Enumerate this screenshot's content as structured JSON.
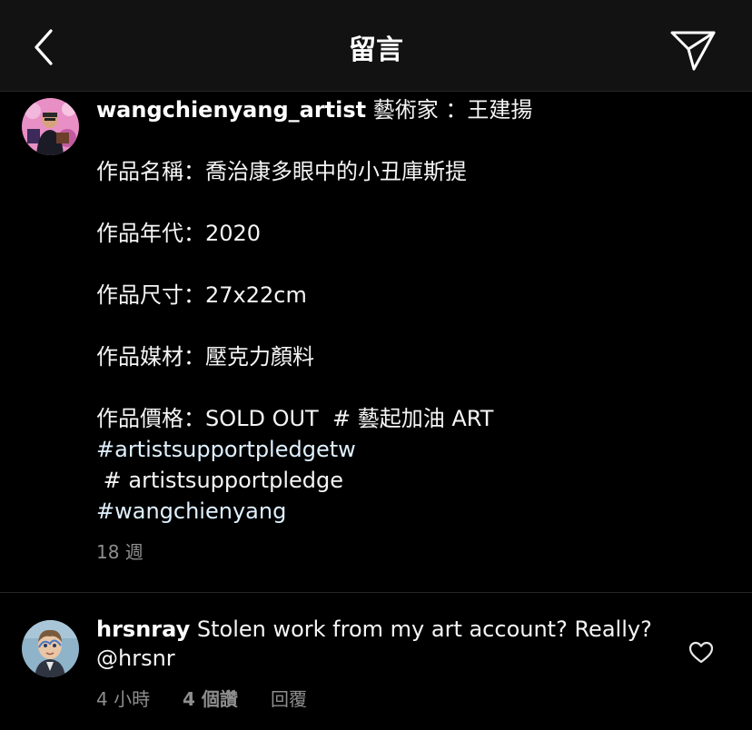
{
  "header": {
    "title": "留言",
    "back_icon": "chevron-left-icon",
    "send_icon": "paper-plane-icon"
  },
  "caption": {
    "username": "wangchienyang_artist",
    "lines": {
      "l0": " 藝術家 ：王建揚",
      "l1": "作品名稱：喬治康多眼中的小丑庫斯提",
      "l2": "作品年代：2020",
      "l3": "作品尺寸：27x22cm",
      "l4": "作品媒材：壓克力顏料",
      "l5": "作品價格：SOLD OUT  # 藝起加油 ART"
    },
    "hashtags": {
      "h0": "#artistsupportpledgetw",
      "h1": " # artistsupportpledge",
      "h2": "#wangchienyang"
    },
    "time": "18 週"
  },
  "comment": {
    "username": "hrsnray",
    "text": " Stolen work from my art account? Really? @hrsnr",
    "time": "4 小時",
    "likes": "4 個讚",
    "reply": "回覆",
    "like_icon": "heart-outline-icon"
  },
  "colors": {
    "background": "#000000",
    "header_background": "#121212",
    "text": "#f5f5f5",
    "secondary_text": "#8e8e8e",
    "hashtag": "#e0f1ff",
    "divider": "#262626"
  }
}
